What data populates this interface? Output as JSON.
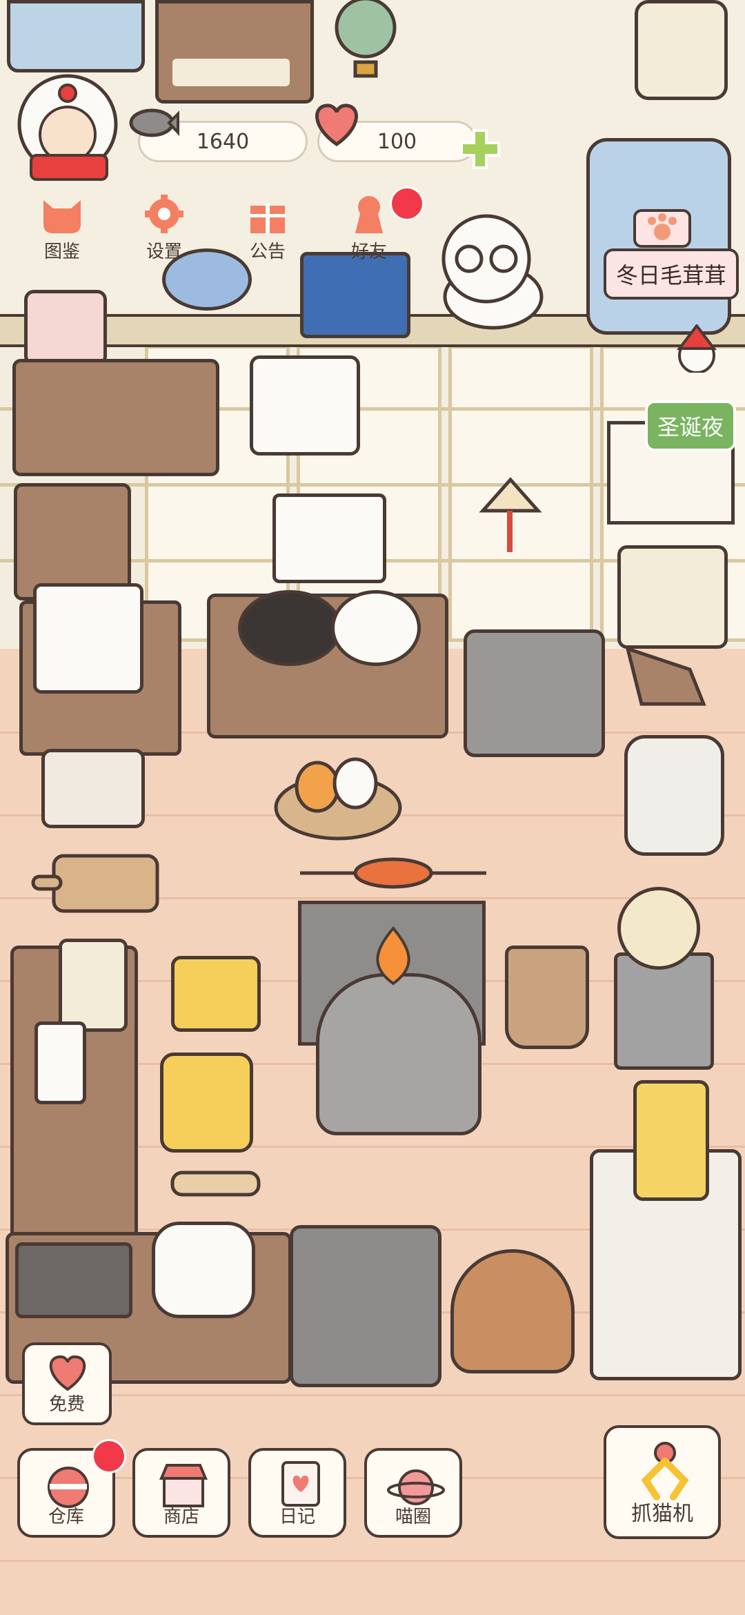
{
  "player": {
    "coins": "1640",
    "hearts": "100"
  },
  "toolbar": [
    {
      "id": "collection",
      "label": "图鉴"
    },
    {
      "id": "settings",
      "label": "设置"
    },
    {
      "id": "notice",
      "label": "公告"
    },
    {
      "id": "friends",
      "label": "好友"
    }
  ],
  "events": {
    "winter_fluffy": "冬日毛茸茸",
    "christmas_eve": "圣诞夜"
  },
  "free_button": {
    "label": "免费"
  },
  "bottom_nav": [
    {
      "id": "warehouse",
      "label": "仓库"
    },
    {
      "id": "shop",
      "label": "商店"
    },
    {
      "id": "diary",
      "label": "日记"
    },
    {
      "id": "cat_circle",
      "label": "喵圈"
    }
  ],
  "claw_machine": {
    "label": "抓猫机"
  },
  "colors": {
    "accent_red": "#f2394a",
    "floor": "#f4d3bd",
    "wall": "#f3ede0",
    "plus_green": "#a6d15a",
    "heart_pink": "#f07a74"
  },
  "icons": [
    "fish-icon",
    "heart-icon",
    "plus-icon",
    "cat-head-icon",
    "gear-icon",
    "gift-icon",
    "keyhole-icon",
    "paw-icon",
    "piggy-bank-icon",
    "shop-icon",
    "diary-icon",
    "planet-cat-icon",
    "claw-icon"
  ]
}
